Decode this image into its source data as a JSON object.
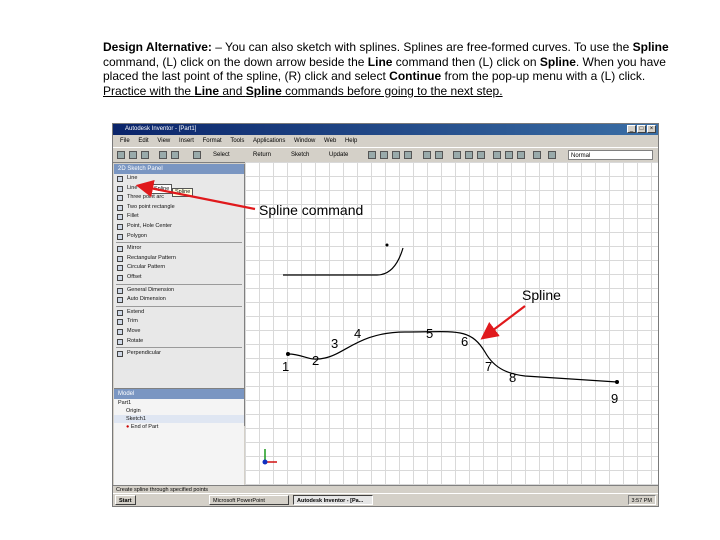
{
  "instructions": {
    "heading": "Design Alternative:",
    "p1": " – You can also sketch with splines. Splines are free-formed curves. To use the ",
    "spline_b1": "Spline",
    "p2": " command, (L) click on the down arrow beside the ",
    "line_b1": "Line",
    "p3": " command then (L) click on ",
    "spline_b2": "Spline",
    "p4": ". When you have placed the last point of the spline, (R) click and select ",
    "continue_b": "Continue",
    "p5": " from the pop-up menu with a (L) click. ",
    "u1": "Practice with the ",
    "line_b2": "Line",
    "u2": " and ",
    "spline_b3": "Spline",
    "u3": " commands before going to the next step."
  },
  "window": {
    "title": "Autodesk Inventor - [Part1]",
    "menu": [
      "File",
      "Edit",
      "View",
      "Insert",
      "Format",
      "Tools",
      "Applications",
      "Window",
      "Web",
      "Help"
    ],
    "toolbar": {
      "select": "Select",
      "return": "Return",
      "sketch": "Sketch",
      "update": "Update",
      "style": "Normal"
    }
  },
  "panel": {
    "title": "2D Sketch Panel",
    "items": [
      "Line",
      "Line",
      "Spline",
      "Three point arc",
      "Two point rectangle",
      "Fillet",
      "Point, Hole Center",
      "Polygon",
      "Mirror",
      "Rectangular Pattern",
      "Circular Pattern",
      "Offset",
      "General Dimension",
      "Auto Dimension",
      "Extend",
      "Trim",
      "Move",
      "Rotate",
      "Perpendicular"
    ],
    "tooltip": "Spline"
  },
  "model": {
    "title": "Model",
    "items": [
      "Part1",
      "Origin",
      "Sketch1",
      "End of Part"
    ]
  },
  "statusbar": {
    "text": "Create spline through specified points"
  },
  "taskbar": {
    "start": "Start",
    "items": [
      "Microsoft PowerPoint",
      "Autodesk Inventor - [Pa..."
    ],
    "clock": "3:57 PM"
  },
  "annotations": {
    "spline_command": "Spline command",
    "spline": "Spline",
    "points": [
      "1",
      "2",
      "3",
      "4",
      "5",
      "6",
      "7",
      "8",
      "9"
    ]
  },
  "colors": {
    "arrow": "#e0191c",
    "title_bar": "#0a246a",
    "panel_header": "#7a96c2"
  }
}
